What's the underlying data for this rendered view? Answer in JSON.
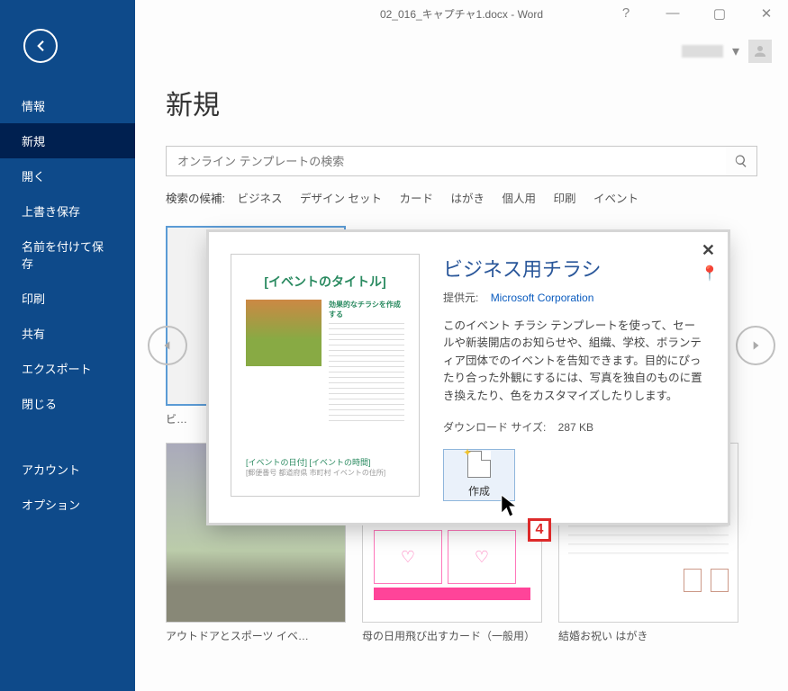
{
  "window": {
    "title": "02_016_キャプチャ1.docx - Word"
  },
  "sidebar": {
    "items": [
      {
        "label": "情報"
      },
      {
        "label": "新規",
        "active": true
      },
      {
        "label": "開く"
      },
      {
        "label": "上書き保存"
      },
      {
        "label": "名前を付けて保存"
      },
      {
        "label": "印刷"
      },
      {
        "label": "共有"
      },
      {
        "label": "エクスポート"
      },
      {
        "label": "閉じる"
      }
    ],
    "items2": [
      {
        "label": "アカウント"
      },
      {
        "label": "オプション"
      }
    ]
  },
  "page": {
    "heading": "新規",
    "search_placeholder": "オンライン テンプレートの検索",
    "suggest_label": "検索の候補:",
    "suggest_tags": [
      "ビジネス",
      "デザイン セット",
      "カード",
      "はがき",
      "個人用",
      "印刷",
      "イベント"
    ]
  },
  "templates": [
    {
      "caption": "ビ…",
      "kind": "flyer",
      "selected": true
    },
    {
      "caption": "アウトドアとスポーツ イベ…",
      "kind": "outdoor"
    },
    {
      "caption": "母の日用飛び出すカード（一般用）",
      "kind": "mothers"
    },
    {
      "caption": "結婚お祝い はがき",
      "kind": "married"
    }
  ],
  "modal": {
    "title": "ビジネス用チラシ",
    "provider_label": "提供元:",
    "provider_name": "Microsoft Corporation",
    "description": "このイベント チラシ テンプレートを使って、セールや新装開店のお知らせや、組織、学校、ボランティア団体でのイベントを告知できます。目的にぴったり合った外観にするには、写真を独自のものに置き換えたり、色をカスタマイズしたりします。",
    "download_label": "ダウンロード サイズ:",
    "download_value": "287 KB",
    "create_label": "作成",
    "preview": {
      "title": "[イベントのタイトル]",
      "subhead": "効果的なチラシを作成する",
      "footer1": "[イベントの日付] [イベントの時間]",
      "footer2": "[郵便番号 都道府県 市町村 イベントの住所]"
    }
  },
  "annotation": {
    "step": "4"
  }
}
